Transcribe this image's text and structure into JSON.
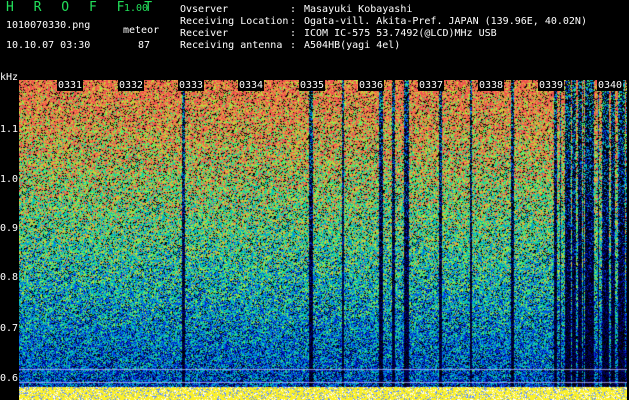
{
  "app": {
    "title": "H R O F F T",
    "version": "1.00"
  },
  "file": {
    "name": "1010070330.png",
    "datetime": "10.10.07 03:30"
  },
  "meteor": {
    "label": "meteor",
    "count": "87"
  },
  "info": [
    {
      "label": "Ovserver",
      "value": "Masayuki Kobayashi"
    },
    {
      "label": "Receiving Location",
      "value": "Ogata-vill. Akita-Pref. JAPAN (139.96E, 40.02N)"
    },
    {
      "label": "Receiver",
      "value": "ICOM IC-575 53.7492(@LCD)MHz USB"
    },
    {
      "label": "Receiving antenna",
      "value": "A504HB(yagi 4el)"
    }
  ],
  "axis": {
    "unit": "kHz",
    "y_ticks": [
      "1.1",
      "1.0",
      "0.9",
      "0.8",
      "0.7",
      "0.6"
    ],
    "x_ticks": [
      "0331",
      "0332",
      "0333",
      "0334",
      "0335",
      "0336",
      "0337",
      "0338",
      "0339",
      "0340"
    ]
  },
  "colors": {
    "title_green": "#22e05a",
    "background": "#000000"
  }
}
